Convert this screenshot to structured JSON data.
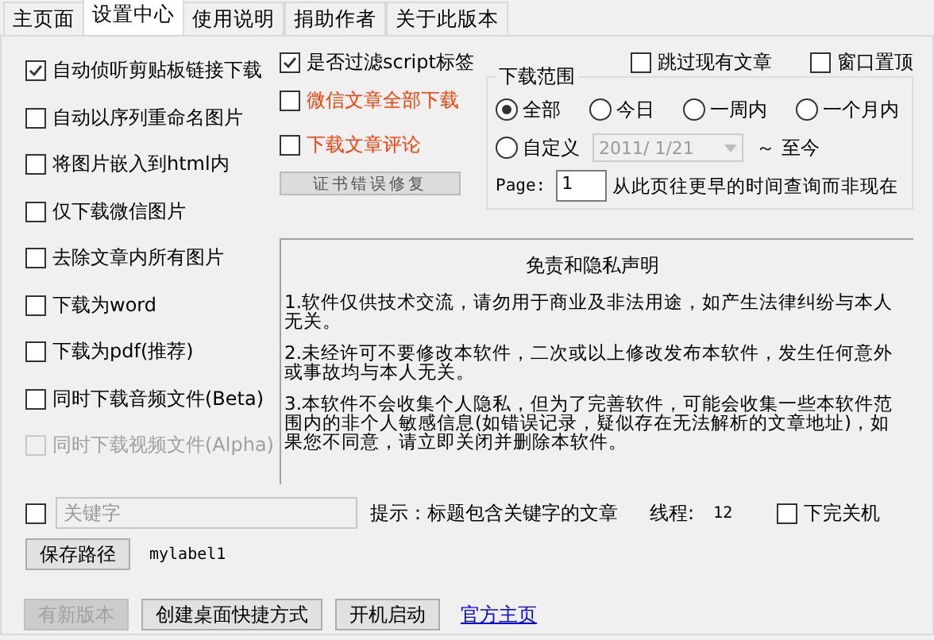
{
  "tabs": [
    {
      "label": "主页面",
      "selected": false
    },
    {
      "label": "设置中心",
      "selected": true
    },
    {
      "label": "使用说明",
      "selected": false
    },
    {
      "label": "捐助作者",
      "selected": false
    },
    {
      "label": "关于此版本",
      "selected": false
    }
  ],
  "options": [
    {
      "label": "自动侦听剪贴板链接下载",
      "checked": true,
      "disabled": false
    },
    {
      "label": "自动以序列重命名图片",
      "checked": false,
      "disabled": false
    },
    {
      "label": "将图片嵌入到html内",
      "checked": false,
      "disabled": false
    },
    {
      "label": "仅下载微信图片",
      "checked": false,
      "disabled": false
    },
    {
      "label": "去除文章内所有图片",
      "checked": false,
      "disabled": false
    },
    {
      "label": "下载为word",
      "checked": false,
      "disabled": false
    },
    {
      "label": "下载为pdf(推荐)",
      "checked": false,
      "disabled": false
    },
    {
      "label": "同时下载音频文件(Beta)",
      "checked": false,
      "disabled": false
    },
    {
      "label": "同时下载视频文件(Alpha)",
      "checked": false,
      "disabled": true
    }
  ],
  "extra_options": [
    {
      "label": "是否过滤script标签",
      "checked": true,
      "warning": false
    },
    {
      "label": "微信文章全部下载",
      "checked": false,
      "warning": true
    },
    {
      "label": "下载文章评论",
      "checked": false,
      "warning": true
    }
  ],
  "fix_button": {
    "label": "证书错误修复"
  },
  "top_options": [
    {
      "label": "跳过现有文章",
      "checked": false
    },
    {
      "label": "窗口置顶",
      "checked": false
    }
  ],
  "download_range": {
    "title": "下载范围",
    "choices": [
      {
        "label": "全部",
        "selected": true
      },
      {
        "label": "今日",
        "selected": false
      },
      {
        "label": "一周内",
        "selected": false
      },
      {
        "label": "一个月内",
        "selected": false
      },
      {
        "label": "自定义",
        "selected": false
      }
    ],
    "date": {
      "value": "2011/ 1/21",
      "disabled": true
    },
    "until": "～ 至今",
    "page_label": "Page:",
    "page_value": "1",
    "page_hint": "从此页往更早的时间查询而非现在"
  },
  "notice": {
    "title": "免责和隐私声明",
    "paragraphs": [
      "1.软件仅供技术交流，请勿用于商业及非法用途，如产生法律纠纷与本人无关。",
      "2.未经许可不要修改本软件，二次或以上修改发布本软件，发生任何意外或事故均与本人无关。",
      "3.本软件不会收集个人隐私，但为了完善软件，可能会收集一些本软件范围内的非个人敏感信息(如错误记录，疑似存在无法解析的文章地址)，如果您不同意，请立即关闭并删除本软件。"
    ]
  },
  "keyword": {
    "checked": false,
    "placeholder": "关键字",
    "hint": "提示：标题包含关键字的文章",
    "threads_label": "线程:",
    "threads_value": "12",
    "shutdown": {
      "label": "下完关机",
      "checked": false
    }
  },
  "save_path": {
    "button": "保存路径",
    "label": "mylabel1"
  },
  "footer": {
    "buttons": [
      {
        "label": "有新版本",
        "disabled": true
      },
      {
        "label": "创建桌面快捷方式",
        "disabled": false
      },
      {
        "label": "开机启动",
        "disabled": false
      }
    ],
    "link": "官方主页"
  }
}
